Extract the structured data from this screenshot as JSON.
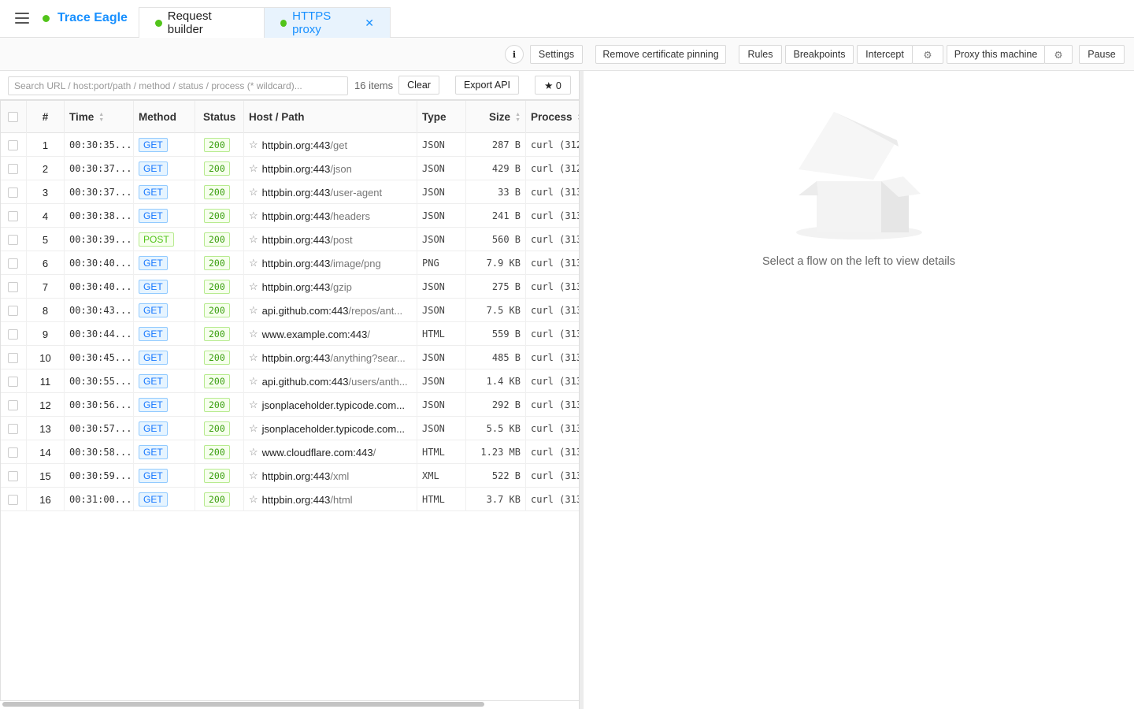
{
  "app": {
    "title": "Trace Eagle"
  },
  "tabs": [
    {
      "label": "Request builder"
    },
    {
      "label": "HTTPS proxy"
    }
  ],
  "toolbar": {
    "settings": "Settings",
    "remove_pinning": "Remove certificate pinning",
    "rules": "Rules",
    "breakpoints": "Breakpoints",
    "intercept": "Intercept",
    "proxy_machine": "Proxy this machine",
    "pause": "Pause"
  },
  "filter": {
    "placeholder": "Search URL / host:port/path / method / status / process (* wildcard)...",
    "count": "16 items",
    "clear": "Clear",
    "export": "Export API",
    "starred": "★ 0"
  },
  "columns": {
    "num": "#",
    "time": "Time",
    "method": "Method",
    "status": "Status",
    "host": "Host / Path",
    "type": "Type",
    "size": "Size",
    "process": "Process"
  },
  "rows": [
    {
      "num": "1",
      "time": "00:30:35....",
      "method": "GET",
      "status": "200",
      "host": "httpbin.org:443",
      "path": "/get",
      "type": "JSON",
      "size": "287 B",
      "process": "curl (312"
    },
    {
      "num": "2",
      "time": "00:30:37....",
      "method": "GET",
      "status": "200",
      "host": "httpbin.org:443",
      "path": "/json",
      "type": "JSON",
      "size": "429 B",
      "process": "curl (312"
    },
    {
      "num": "3",
      "time": "00:30:37....",
      "method": "GET",
      "status": "200",
      "host": "httpbin.org:443",
      "path": "/user-agent",
      "type": "JSON",
      "size": "33 B",
      "process": "curl (313"
    },
    {
      "num": "4",
      "time": "00:30:38....",
      "method": "GET",
      "status": "200",
      "host": "httpbin.org:443",
      "path": "/headers",
      "type": "JSON",
      "size": "241 B",
      "process": "curl (313"
    },
    {
      "num": "5",
      "time": "00:30:39....",
      "method": "POST",
      "status": "200",
      "host": "httpbin.org:443",
      "path": "/post",
      "type": "JSON",
      "size": "560 B",
      "process": "curl (313"
    },
    {
      "num": "6",
      "time": "00:30:40....",
      "method": "GET",
      "status": "200",
      "host": "httpbin.org:443",
      "path": "/image/png",
      "type": "PNG",
      "size": "7.9 KB",
      "process": "curl (313"
    },
    {
      "num": "7",
      "time": "00:30:40....",
      "method": "GET",
      "status": "200",
      "host": "httpbin.org:443",
      "path": "/gzip",
      "type": "JSON",
      "size": "275 B",
      "process": "curl (313"
    },
    {
      "num": "8",
      "time": "00:30:43....",
      "method": "GET",
      "status": "200",
      "host": "api.github.com:443",
      "path": "/repos/ant...",
      "type": "JSON",
      "size": "7.5 KB",
      "process": "curl (313"
    },
    {
      "num": "9",
      "time": "00:30:44....",
      "method": "GET",
      "status": "200",
      "host": "www.example.com:443",
      "path": "/",
      "type": "HTML",
      "size": "559 B",
      "process": "curl (313"
    },
    {
      "num": "10",
      "time": "00:30:45....",
      "method": "GET",
      "status": "200",
      "host": "httpbin.org:443",
      "path": "/anything?sear...",
      "type": "JSON",
      "size": "485 B",
      "process": "curl (313"
    },
    {
      "num": "11",
      "time": "00:30:55....",
      "method": "GET",
      "status": "200",
      "host": "api.github.com:443",
      "path": "/users/anth...",
      "type": "JSON",
      "size": "1.4 KB",
      "process": "curl (313"
    },
    {
      "num": "12",
      "time": "00:30:56....",
      "method": "GET",
      "status": "200",
      "host": "jsonplaceholder.typicode.com...",
      "path": "",
      "type": "JSON",
      "size": "292 B",
      "process": "curl (313"
    },
    {
      "num": "13",
      "time": "00:30:57....",
      "method": "GET",
      "status": "200",
      "host": "jsonplaceholder.typicode.com...",
      "path": "",
      "type": "JSON",
      "size": "5.5 KB",
      "process": "curl (313"
    },
    {
      "num": "14",
      "time": "00:30:58....",
      "method": "GET",
      "status": "200",
      "host": "www.cloudflare.com:443",
      "path": "/",
      "type": "HTML",
      "size": "1.23 MB",
      "process": "curl (313"
    },
    {
      "num": "15",
      "time": "00:30:59....",
      "method": "GET",
      "status": "200",
      "host": "httpbin.org:443",
      "path": "/xml",
      "type": "XML",
      "size": "522 B",
      "process": "curl (313"
    },
    {
      "num": "16",
      "time": "00:31:00....",
      "method": "GET",
      "status": "200",
      "host": "httpbin.org:443",
      "path": "/html",
      "type": "HTML",
      "size": "3.7 KB",
      "process": "curl (313"
    }
  ],
  "detail": {
    "empty": "Select a flow on the left to view details"
  },
  "colors": {
    "accent": "#1890ff",
    "live": "#52c41a"
  }
}
